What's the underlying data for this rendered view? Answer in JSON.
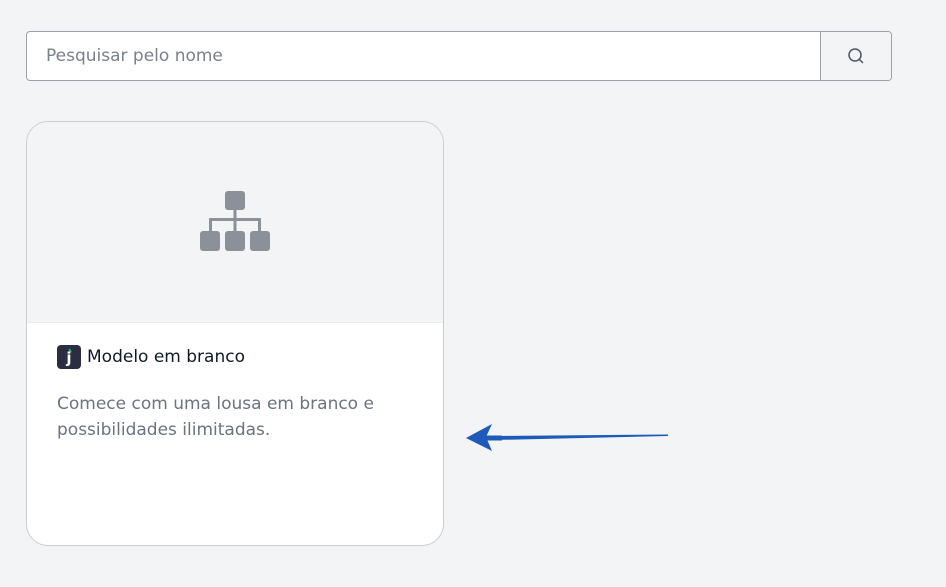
{
  "search": {
    "placeholder": "Pesquisar pelo nome",
    "value": ""
  },
  "icons": {
    "search": "search-icon",
    "preview": "org-chart-icon",
    "app_logo": "app-logo-j",
    "annotation": "arrow-left-icon"
  },
  "card": {
    "logo_letter": "j",
    "title": "Modelo em branco",
    "description": "Comece com uma lousa em branco e possibilidades ilimitadas."
  },
  "colors": {
    "background": "#f3f4f6",
    "icon_gray": "#8a9199",
    "logo_bg": "#2b2d42",
    "logo_accent": "#22c55e",
    "arrow_blue": "#1e5bb8"
  }
}
